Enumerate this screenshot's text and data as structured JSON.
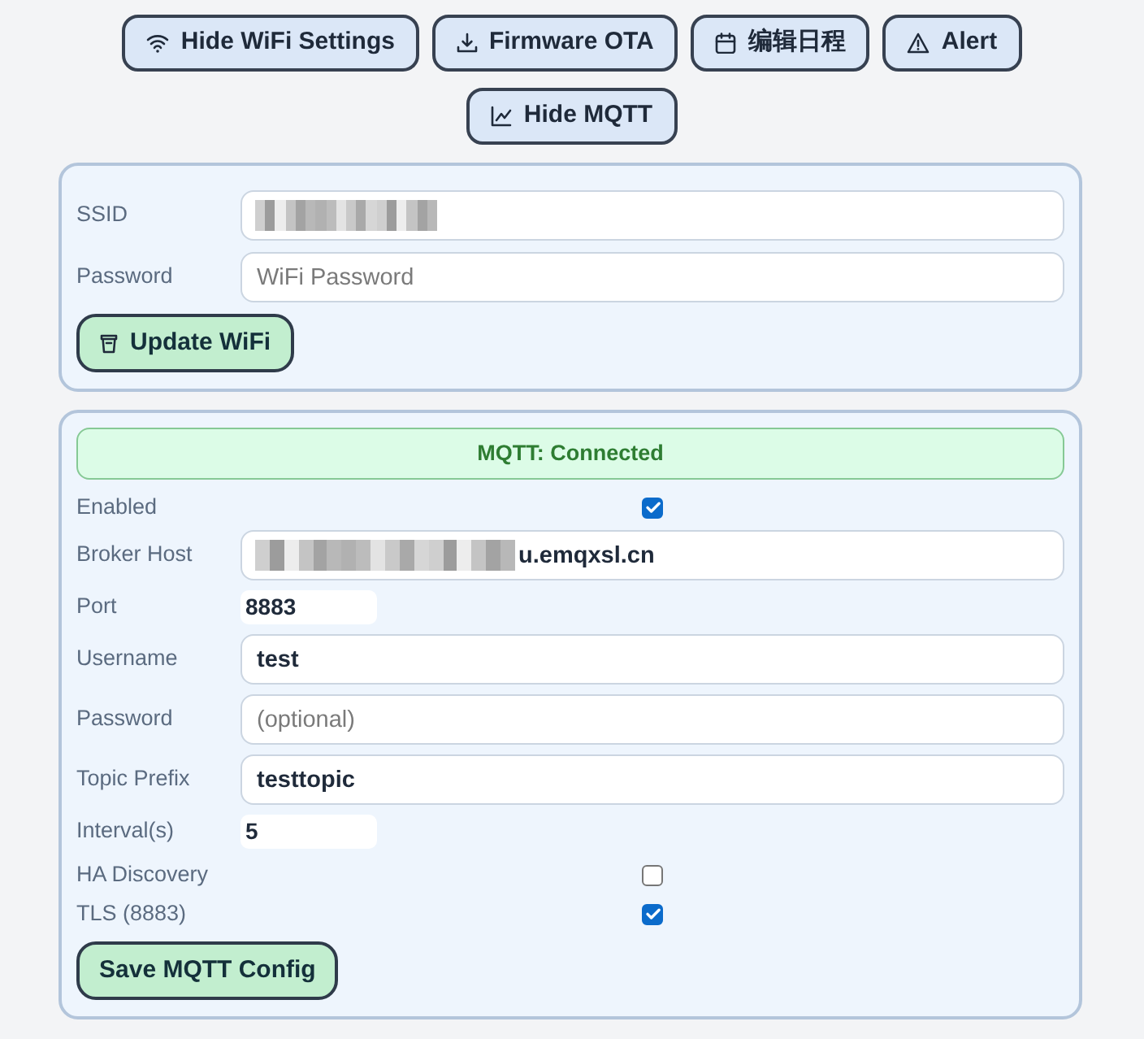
{
  "toolbar": {
    "buttons": [
      {
        "label": "Hide WiFi Settings"
      },
      {
        "label": "Firmware OTA"
      },
      {
        "label": "编辑日程"
      },
      {
        "label": "Alert"
      },
      {
        "label": "Hide MQTT"
      }
    ]
  },
  "wifi": {
    "fields": [
      {
        "label": "SSID",
        "kind": "text",
        "redacted": true
      },
      {
        "label": "Password",
        "kind": "text",
        "placeholder": "WiFi Password",
        "redacted": false
      }
    ],
    "button": {
      "label": "Update WiFi"
    }
  },
  "mqtt": {
    "status": {
      "text": "MQTT: Connected",
      "connected": true
    },
    "fields": [
      {
        "label": "Enabled",
        "kind": "checkbox",
        "checked": true
      },
      {
        "label": "Broker Host",
        "kind": "text",
        "value": "u.emqxsl.cn",
        "redacted": true
      },
      {
        "label": "Port",
        "kind": "number",
        "value": "8883"
      },
      {
        "label": "Username",
        "kind": "text",
        "value": "test",
        "redacted": false
      },
      {
        "label": "Password",
        "kind": "text",
        "placeholder": "(optional)",
        "redacted": false
      },
      {
        "label": "Topic Prefix",
        "kind": "text",
        "value": "testtopic",
        "redacted": false
      },
      {
        "label": "Interval(s)",
        "kind": "number",
        "value": "5"
      },
      {
        "label": "HA Discovery",
        "kind": "checkbox",
        "checked": false
      },
      {
        "label": "TLS (8883)",
        "kind": "checkbox",
        "checked": true
      }
    ],
    "button": {
      "label": "Save MQTT Config"
    }
  }
}
